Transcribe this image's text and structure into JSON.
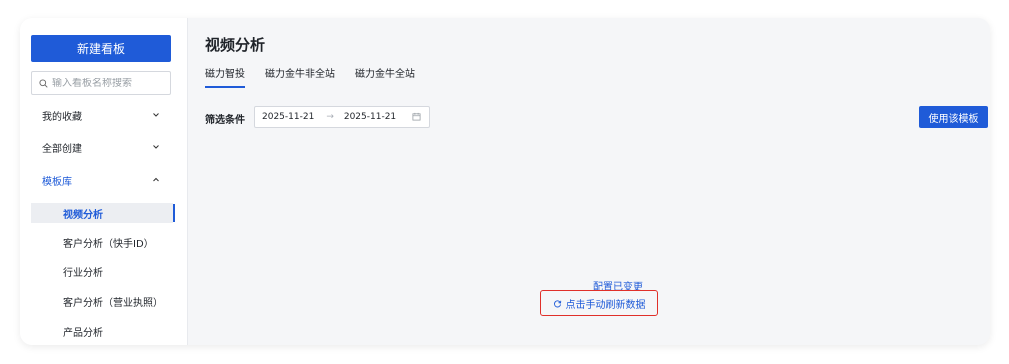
{
  "sidebar": {
    "new_board": "新建看板",
    "search_placeholder": "输入看板名称搜索",
    "items": [
      {
        "label": "我的收藏"
      },
      {
        "label": "全部创建"
      },
      {
        "label": "模板库"
      }
    ],
    "templates": [
      {
        "label": "视频分析"
      },
      {
        "label": "客户分析（快手ID）"
      },
      {
        "label": "行业分析"
      },
      {
        "label": "客户分析（营业执照）"
      },
      {
        "label": "产品分析"
      }
    ]
  },
  "main": {
    "title": "视频分析",
    "tabs": [
      {
        "label": "磁力智投"
      },
      {
        "label": "磁力金牛非全站"
      },
      {
        "label": "磁力金牛全站"
      }
    ],
    "filter_label": "筛选条件",
    "date_start": "2025-11-21",
    "date_end": "2025-11-21",
    "use_template": "使用该模板",
    "notice": "配置已变更",
    "refresh": "点击手动刷新数据"
  },
  "colors": {
    "accent": "#1f5bd8",
    "highlight_border": "#e0302a"
  }
}
